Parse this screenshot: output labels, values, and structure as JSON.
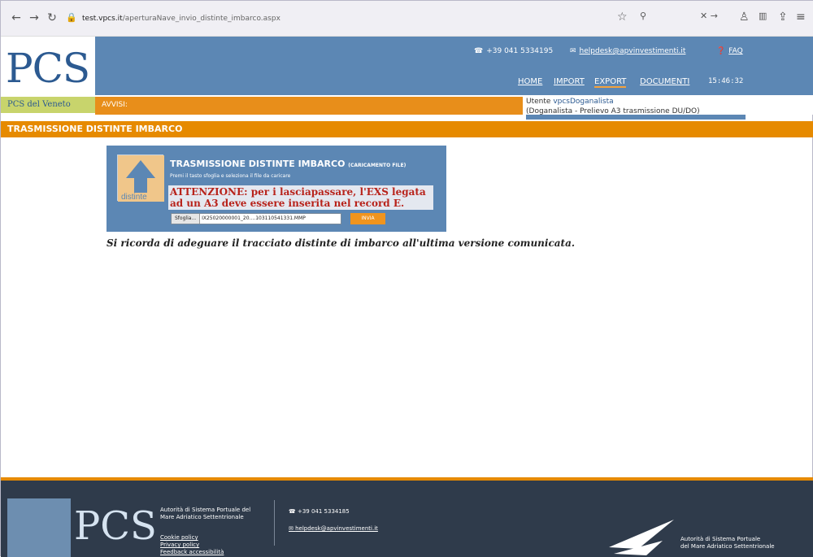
{
  "browser": {
    "url_domain": "test.vpcs.it",
    "url_path": "/aperturaNave_invio_distinte_imbarco.aspx"
  },
  "header": {
    "logo": "PCS",
    "logo_subtitle": "PCS del Veneto",
    "phone": "+39 041 5334195",
    "email": "helpdesk@apvinvestimenti.it",
    "faq": "FAQ",
    "menu": [
      "HOME",
      "IMPORT",
      "EXPORT",
      "DOCUMENTI"
    ],
    "active_menu": "EXPORT",
    "time": "15:46:32",
    "avvisi": "AVVISI:",
    "user_label": "Utente",
    "user_name": "vpcsDoganalista",
    "user_role": "(Doganalista - Prelievo A3 trasmissione DU/DO)"
  },
  "page": {
    "title": "TRASMISSIONE DISTINTE IMBARCO"
  },
  "panel": {
    "icon_label": "distinte",
    "title": "TRASMISSIONE DISTINTE IMBARCO",
    "title_suffix": "(CARICAMENTO FILE)",
    "hint": "Premi il tasto sfoglia e seleziona il file da caricare",
    "warning": "ATTENZIONE: per i lasciapassare, l'EXS legata ad un A3 deve essere inserita nel record E.",
    "browse_label": "Sfoglia...",
    "file_value": "IX25020000001_20....103110541331.MMP",
    "submit_label": "INVIA"
  },
  "reminder": "Si ricorda di adeguare il tracciato distinte di imbarco all'ultima versione comunicata.",
  "footer": {
    "org_line1": "Autorità di Sistema Portuale del",
    "org_line2": "Mare Adriatico Settentrionale",
    "links": [
      "Cookie policy",
      "Privacy policy",
      "Feedback accessibilità"
    ],
    "phone": "+39 041 5334185",
    "email": "helpdesk@apvinvestimenti.it",
    "auth_line1": "Autorità di Sistema Portuale",
    "auth_line2": "del Mare Adriatico Settentrionale"
  }
}
